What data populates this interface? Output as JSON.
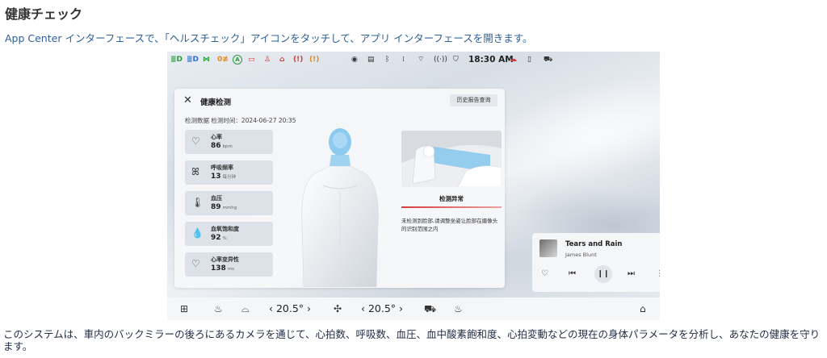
{
  "doc": {
    "title": "健康チェック",
    "intro": "App Center インターフェースで、「ヘルスチェック」アイコンをタッチして、アプリ インターフェースを開きます。",
    "body": "このシステムは、車内のバックミラーの後ろにあるカメラを通じて、心拍数、呼吸数、血圧、血中酸素飽和度、心拍変動などの現在の身体パラメータを分析し、あなたの健康を守ります。"
  },
  "statusbar": {
    "time": "18:30 AM",
    "telltales": [
      {
        "icon": "high-beam-icon",
        "glyph": "≣D",
        "color": "#2d9b3c"
      },
      {
        "icon": "low-beam-icon",
        "glyph": "≣D",
        "color": "#2d6fd0"
      },
      {
        "icon": "side-lights-icon",
        "glyph": "⋈",
        "color": "#2d9b3c"
      },
      {
        "icon": "fog-light-icon",
        "glyph": "0≢",
        "color": "#e08a1a"
      },
      {
        "icon": "auto-hold-icon",
        "glyph": "A",
        "color": "#2d9b3c"
      },
      {
        "icon": "battery-warning-icon",
        "glyph": "▭",
        "color": "#d23b3b"
      },
      {
        "icon": "seatbelt-warning-icon",
        "glyph": "♙",
        "color": "#d23b3b"
      },
      {
        "icon": "door-open-icon",
        "glyph": "⌂",
        "color": "#d23b3b"
      },
      {
        "icon": "brake-warning-icon",
        "glyph": "(!)",
        "color": "#d23b3b"
      },
      {
        "icon": "tire-pressure-icon",
        "glyph": "(!)",
        "color": "#e08a1a"
      }
    ],
    "system_icons": [
      {
        "icon": "profile-icon",
        "glyph": "◉"
      },
      {
        "icon": "camera-icon",
        "glyph": "▤"
      },
      {
        "icon": "bluetooth-icon",
        "glyph": "ᛒ"
      },
      {
        "icon": "signal-icon",
        "glyph": "⁞"
      },
      {
        "icon": "wifi-icon",
        "glyph": "⌔"
      },
      {
        "icon": "hotspot-icon",
        "glyph": "((·))"
      },
      {
        "icon": "security-icon",
        "glyph": "⛉"
      }
    ],
    "right_icons": [
      {
        "icon": "cloud-icon",
        "glyph": "☁"
      },
      {
        "icon": "phone-icon",
        "glyph": "▯"
      },
      {
        "icon": "car-icon",
        "glyph": "⛟"
      }
    ]
  },
  "panel": {
    "title": "健康检测",
    "history_button": "历史报告查询",
    "subtitle_label": "检测数据",
    "subtitle_time": "检测时间：2024-06-27 20:35",
    "metrics": [
      {
        "icon": "heart-rate-icon",
        "glyph": "♡",
        "name": "心率",
        "value": "86",
        "unit": "bpm"
      },
      {
        "icon": "lungs-icon",
        "glyph": "ꕤ",
        "name": "呼吸频率",
        "value": "13",
        "unit": "每分钟"
      },
      {
        "icon": "thermometer-icon",
        "glyph": "🌡",
        "name": "血压",
        "value": "89",
        "unit": "mmhg"
      },
      {
        "icon": "blood-drop-icon",
        "glyph": "💧",
        "name": "血氧饱和度",
        "value": "92",
        "unit": "%"
      },
      {
        "icon": "heart-pulse-icon",
        "glyph": "♡",
        "name": "心率变异性",
        "value": "138",
        "unit": "ms"
      }
    ],
    "result_title": "检测异常",
    "result_desc": "未检测到脸部,请调整坐姿让脸部在摄像头的识别范围之内"
  },
  "music": {
    "song": "Tears and Rain",
    "artist": "James Blunt"
  },
  "bottombar": {
    "temp_left": "‹ 20.5° ›",
    "temp_right": "‹ 20.5° ›"
  }
}
